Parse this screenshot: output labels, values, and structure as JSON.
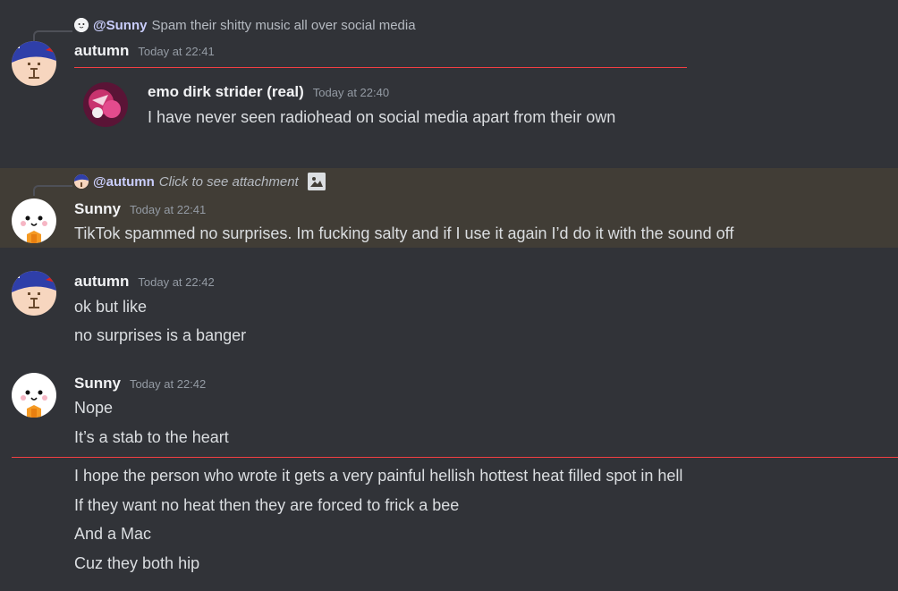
{
  "messages": {
    "m1": {
      "reply_mention": "@Sunny",
      "reply_text": "Spam their shitty music all over social media",
      "author": "autumn",
      "time": "Today at 22:41",
      "quoted": {
        "author": "emo dirk strider (real)",
        "time": "Today at 22:40",
        "text": "I have never seen radiohead on social media apart from their own"
      }
    },
    "m2": {
      "reply_mention": "@autumn",
      "reply_text": "Click to see attachment",
      "author": "Sunny",
      "time": "Today at 22:41",
      "text": "TikTok spammed no surprises. Im fucking salty and if I use it again I’d do it with the sound off"
    },
    "m3": {
      "author": "autumn",
      "time": "Today at 22:42",
      "lines": [
        "ok but like",
        "no surprises is a banger"
      ]
    },
    "m4": {
      "author": "Sunny",
      "time": "Today at 22:42",
      "lines": [
        "Nope",
        "It’s a stab to the heart"
      ]
    },
    "m5": {
      "lines": [
        "I hope the person who wrote it gets a very painful hellish hottest heat filled spot in hell",
        "If they want no heat then they are forced to frick a bee",
        "And a Mac",
        "Cuz they both hip"
      ]
    }
  },
  "colors": {
    "background": "#313338",
    "highlight": "#413d36",
    "new_divider": "#f23f43",
    "mention": "#c9cdfb"
  }
}
